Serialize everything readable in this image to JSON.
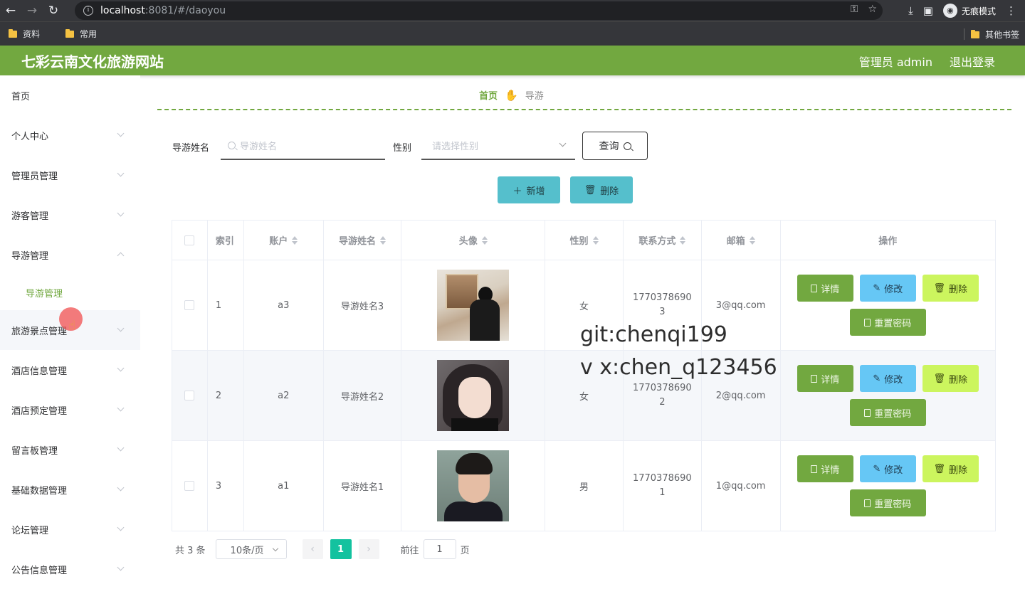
{
  "browser": {
    "url_host": "localhost",
    "url_path": ":8081/#/daoyou",
    "incognito_label": "无痕模式",
    "bookmarks": [
      "资料",
      "常用"
    ],
    "other_bookmarks": "其他书签"
  },
  "header": {
    "title": "七彩云南文化旅游网站",
    "user": "管理员 admin",
    "logout": "退出登录",
    "color": "#72a840"
  },
  "sidebar": {
    "items": [
      {
        "label": "首页"
      },
      {
        "label": "个人中心"
      },
      {
        "label": "管理员管理"
      },
      {
        "label": "游客管理"
      },
      {
        "label": "导游管理"
      },
      {
        "label": "旅游景点管理"
      },
      {
        "label": "酒店信息管理"
      },
      {
        "label": "酒店预定管理"
      },
      {
        "label": "留言板管理"
      },
      {
        "label": "基础数据管理"
      },
      {
        "label": "论坛管理"
      },
      {
        "label": "公告信息管理"
      }
    ],
    "active_submenu": "导游管理"
  },
  "breadcrumb": {
    "home": "首页",
    "current": "导游"
  },
  "search": {
    "name_label": "导游姓名",
    "name_placeholder": "导游姓名",
    "gender_label": "性别",
    "gender_placeholder": "请选择性别",
    "query_button": "查询"
  },
  "actions": {
    "add": "新增",
    "delete": "删除"
  },
  "table": {
    "columns": [
      "索引",
      "账户",
      "导游姓名",
      "头像",
      "性别",
      "联系方式",
      "邮箱",
      "操作"
    ],
    "rows": [
      {
        "index": "1",
        "account": "a3",
        "name": "导游姓名3",
        "gender": "女",
        "phone": "17703786903",
        "email": "3@qq.com"
      },
      {
        "index": "2",
        "account": "a2",
        "name": "导游姓名2",
        "gender": "女",
        "phone": "17703786902",
        "email": "2@qq.com"
      },
      {
        "index": "3",
        "account": "a1",
        "name": "导游姓名1",
        "gender": "男",
        "phone": "17703786901",
        "email": "1@qq.com"
      }
    ],
    "row_buttons": {
      "detail": "详情",
      "edit": "修改",
      "delete": "删除",
      "reset": "重置密码"
    }
  },
  "watermark": {
    "line1": "git:chenqi199",
    "line2": "v x:chen_q123456"
  },
  "pagination": {
    "total": "共 3 条",
    "page_size": "10条/页",
    "current_page": "1",
    "goto_label": "前往",
    "goto_value": "1",
    "page_suffix": "页"
  }
}
